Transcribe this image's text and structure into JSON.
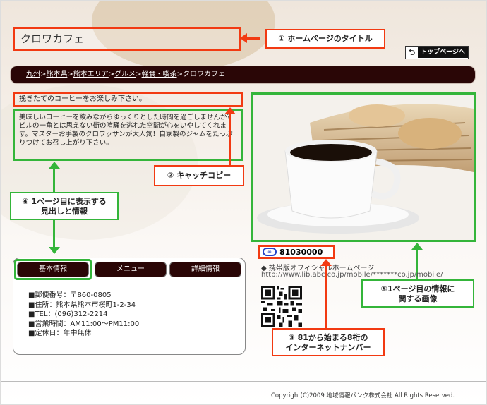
{
  "site": {
    "title": "クロワカフェ",
    "top_page_label": "トップページへ"
  },
  "breadcrumb": {
    "items": [
      "九州",
      "熊本県",
      "熊本エリア",
      "グルメ",
      "軽食・喫茶"
    ],
    "separator": ">",
    "current": "クロワカフェ"
  },
  "catch_copy": "挽きたてのコーヒーをお楽しみ下さい。",
  "body_text": "美味しいコーヒーを飲みながらゆっくりとした時間を過ごしませんか？ビルの一角とは思えない街の喧騒を逃れた空間が心をいやしてくれます。マスターお手製のクロワッサンが大人気！自家製のジャムをたっぷりつけてお召し上がり下さい。",
  "tabs": [
    "基本情報",
    "メニュー",
    "詳細情報"
  ],
  "info": [
    "■郵便番号：〒860-0805",
    "■住所：熊本県熊本市桜町1-2-34",
    "■TEL：(096)312-2214",
    "■営業時間：AM11:00〜PM11:00",
    "■定休日：年中無休"
  ],
  "internet_number": "81030000",
  "mobile": {
    "label": "◆ 携帯版オフィシャルホームページ",
    "url": "http://www.lib.abc.co.jp/mobile/*******co.jp/mobile/"
  },
  "callouts": {
    "c1": "① ホームページのタイトル",
    "c2": "② キャッチコピー",
    "c3_line1": "③ 81から始まる8桁の",
    "c3_line2": "インターネットナンバー",
    "c4_line1": "④ 1ページ目に表示する",
    "c4_line2": "見出しと情報",
    "c5_line1": "⑤1ページ目の情報に",
    "c5_line2": "関する画像"
  },
  "footer": {
    "copyright": "Copyright(C)2009 地域情報バンク株式会社 All Rights Reserved."
  },
  "colors": {
    "accent_red": "#f23a12",
    "accent_green": "#34b53a",
    "dark_brown": "#2a0606"
  },
  "icons": {
    "top_button": "return-arrow-icon",
    "internet_number": "i-mode-logo-icon"
  }
}
